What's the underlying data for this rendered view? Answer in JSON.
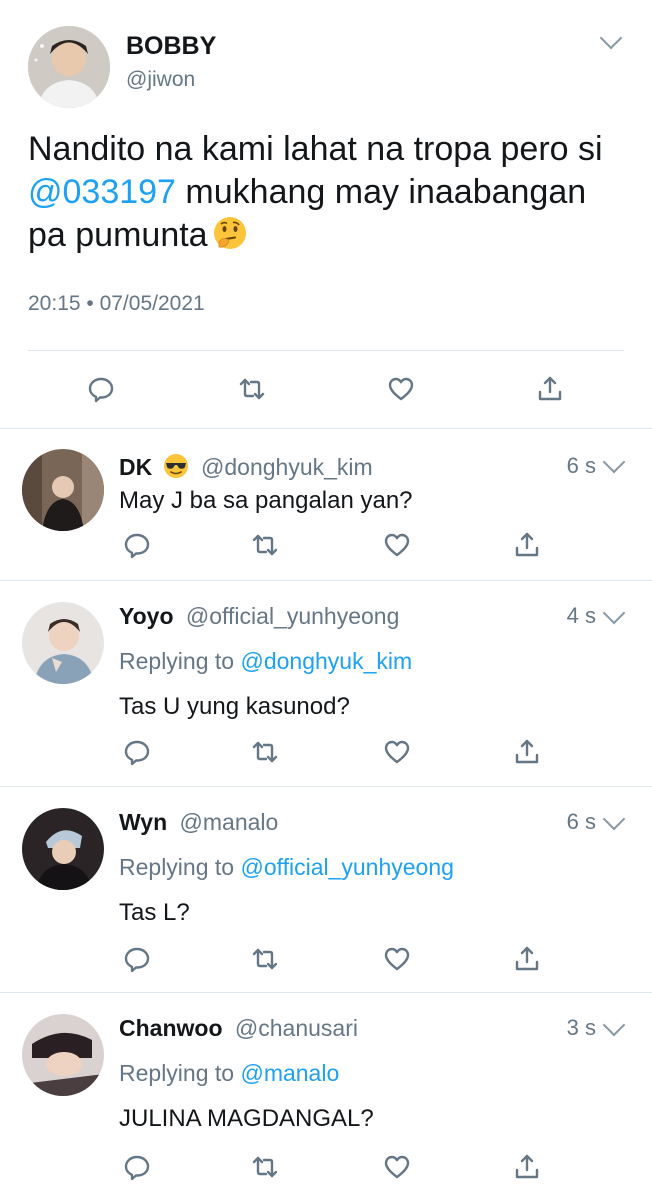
{
  "main_tweet": {
    "name": "BOBBY",
    "handle": "@jiwon",
    "text_before": "Nandito na kami lahat na tropa pero si ",
    "mention": "@033197",
    "text_after": " mukhang may inaabangan pa pumunta",
    "timestamp": "20:15 • 07/05/2021"
  },
  "replies": [
    {
      "name": "DK",
      "handle": "@donghyuk_kim",
      "time": "6 s",
      "text": "May J ba sa pangalan yan?"
    },
    {
      "name": "Yoyo",
      "handle": "@official_yunhyeong",
      "time": "4 s",
      "replying_prefix": "Replying to ",
      "replying_to": "@donghyuk_kim",
      "text": "Tas U yung kasunod?"
    },
    {
      "name": "Wyn",
      "handle": "@manalo",
      "time": "6 s",
      "replying_prefix": "Replying to ",
      "replying_to": "@official_yunhyeong",
      "text": "Tas L?"
    },
    {
      "name": "Chanwoo",
      "handle": "@chanusari",
      "time": "3 s",
      "replying_prefix": "Replying to ",
      "replying_to": "@manalo",
      "text": "JULINA MAGDANGAL?"
    }
  ],
  "icons": {
    "reply": "comment-bubble-icon",
    "retweet": "retweet-icon",
    "like": "heart-icon",
    "share": "share-icon",
    "menu": "chevron-down-icon",
    "emoji_dk": "sunglasses-emoji",
    "emoji_main": "thinking-face-emoji"
  },
  "colors": {
    "link": "#1da1f2",
    "secondary_text": "#657786",
    "icon": "#657786",
    "divider": "#e1e8ed"
  }
}
